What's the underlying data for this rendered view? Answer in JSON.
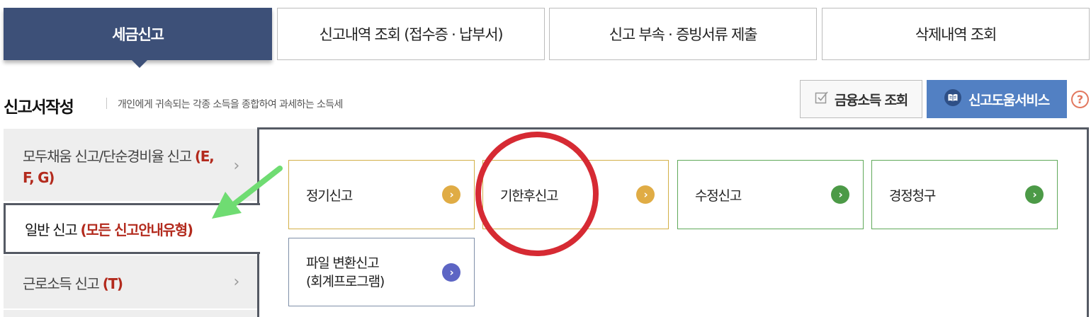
{
  "tabs": [
    {
      "label": "세금신고",
      "active": true
    },
    {
      "label": "신고내역 조회 (접수증 · 납부서)",
      "active": false
    },
    {
      "label": "신고 부속 · 증빙서류 제출",
      "active": false
    },
    {
      "label": "삭제내역 조회",
      "active": false
    }
  ],
  "section": {
    "title": "신고서작성",
    "description": "개인에게 귀속되는 각종 소득을 종합하여 과세하는 소득세"
  },
  "buttons": {
    "financial_income": "금융소득 조회",
    "help_service": "신고도움서비스",
    "help_q": "?"
  },
  "side_menu": [
    {
      "label": "모두채움 신고/단순경비율 신고 ",
      "highlight": "(E, F, G)"
    },
    {
      "label": "일반 신고 ",
      "highlight": "(모든 신고안내유형)",
      "selected": true
    },
    {
      "label": "근로소득 신고 ",
      "highlight": "(T)"
    }
  ],
  "cards": [
    {
      "label": "정기신고",
      "color": "yellow"
    },
    {
      "label": "기한후신고",
      "color": "yellow"
    },
    {
      "label": "수정신고",
      "color": "green"
    },
    {
      "label": "경정청구",
      "color": "green"
    },
    {
      "label_line1": "파일 변환신고",
      "label_line2": "(회계프로그램)",
      "color": "blue"
    }
  ],
  "icons": {
    "chevron": "›",
    "go": "›",
    "checkbox": "checkbox-icon",
    "book": "book-icon"
  },
  "colors": {
    "tab_active": "#3d5078",
    "help_button": "#5280c3",
    "highlight_red": "#b32a1d",
    "card_yellow": "#d3b047",
    "card_green": "#60a95a",
    "annotation_circle": "#d62a33",
    "annotation_arrow": "#6fdc72"
  }
}
